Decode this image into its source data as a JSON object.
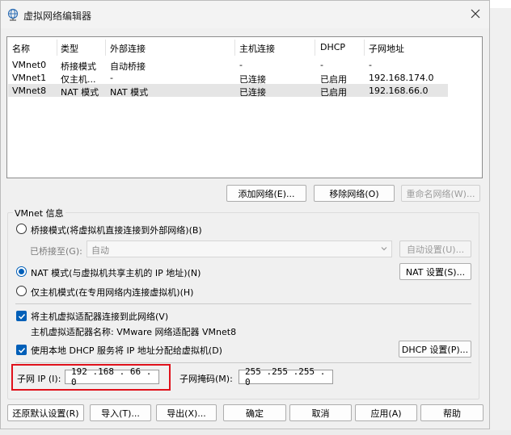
{
  "window": {
    "title": "虚拟网络编辑器",
    "close_label": "✕"
  },
  "table": {
    "headers": [
      "名称",
      "类型",
      "外部连接",
      "主机连接",
      "DHCP",
      "子网地址"
    ],
    "rows": [
      [
        "VMnet0",
        "桥接模式",
        "自动桥接",
        "-",
        "-",
        "-"
      ],
      [
        "VMnet1",
        "仅主机...",
        "-",
        "已连接",
        "已启用",
        "192.168.174.0"
      ],
      [
        "VMnet8",
        "NAT 模式",
        "NAT 模式",
        "已连接",
        "已启用",
        "192.168.66.0"
      ]
    ],
    "selected_row": 2
  },
  "actions": {
    "add_network": "添加网络(E)...",
    "remove_network": "移除网络(O)",
    "rename_network": "重命名网络(W)..."
  },
  "vmnet_info": {
    "group_title": "VMnet 信息",
    "bridged_label": "桥接模式(将虚拟机直接连接到外部网络)(B)",
    "bridged_to_label": "已桥接至(G):",
    "bridged_to_value": "自动",
    "auto_settings": "自动设置(U)...",
    "nat_label": "NAT 模式(与虚拟机共享主机的 IP 地址)(N)",
    "nat_settings": "NAT 设置(S)...",
    "hostonly_label": "仅主机模式(在专用网络内连接虚拟机)(H)",
    "connect_adapter_label": "将主机虚拟适配器连接到此网络(V)",
    "adapter_name_label": "主机虚拟适配器名称: VMware 网络适配器 VMnet8",
    "use_dhcp_label": "使用本地 DHCP 服务将 IP 地址分配给虚拟机(D)",
    "dhcp_settings": "DHCP 设置(P)...",
    "subnet_ip_label": "子网 IP (I):",
    "subnet_ip_value": "192 .168 . 66  .  0",
    "subnet_mask_label": "子网掩码(M):",
    "subnet_mask_value": "255 .255 .255 .  0",
    "mode_selected": "nat"
  },
  "footer": {
    "restore_defaults": "还原默认设置(R)",
    "import": "导入(T)...",
    "export": "导出(X)...",
    "ok": "确定",
    "cancel": "取消",
    "apply": "应用(A)",
    "help": "帮助"
  },
  "colors": {
    "accent": "#005fb8",
    "highlight_box": "#e0111b"
  }
}
